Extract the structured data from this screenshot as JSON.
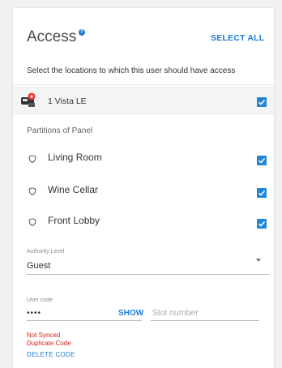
{
  "header": {
    "title": "Access",
    "info_icon": "info-icon",
    "select_all_label": "SELECT ALL"
  },
  "subtitle": "Select the locations to which this user should have access",
  "panel": {
    "icon": "panel-device-icon",
    "name": "1 Vista LE",
    "checked": true
  },
  "partitions": {
    "label": "Partitions of Panel",
    "items": [
      {
        "label": "Living Room",
        "icon": "shield-icon",
        "checked": true
      },
      {
        "label": "Wine Cellar",
        "icon": "shield-icon",
        "checked": true
      },
      {
        "label": "Front Lobby",
        "icon": "shield-icon",
        "checked": true
      }
    ]
  },
  "authority": {
    "label": "Authority Level",
    "value": "Guest",
    "icon": "caret-down-icon"
  },
  "user_code": {
    "label": "User code",
    "value": "••••",
    "show_label": "SHOW",
    "slot_placeholder": "Slot number"
  },
  "errors": [
    "Not Synced",
    "Duplicate Code"
  ],
  "delete_label": "DELETE CODE",
  "colors": {
    "accent": "#1f7bd6",
    "checkbox": "#1f86d8",
    "error": "#d0251d",
    "panel_badge": "#e53935"
  }
}
